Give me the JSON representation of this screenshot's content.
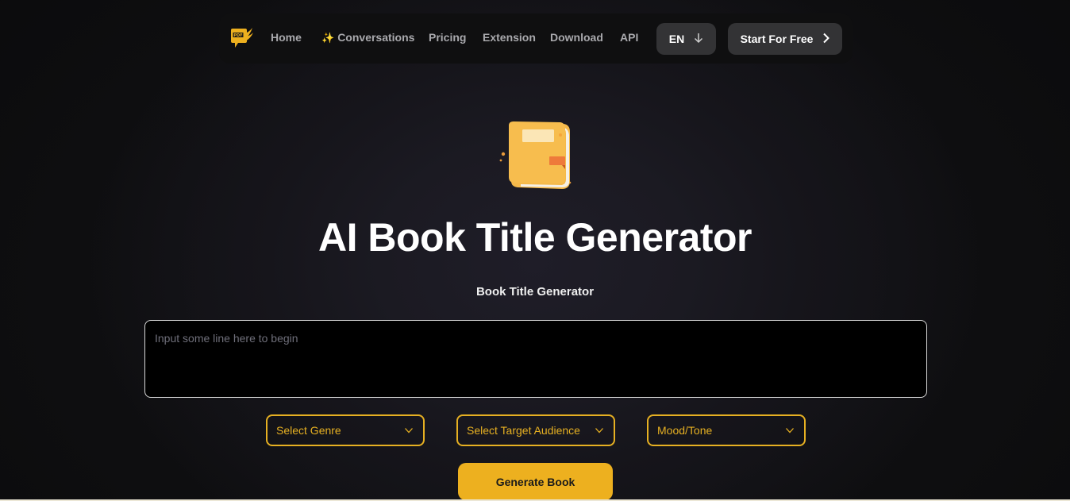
{
  "nav": {
    "logo_text": "PDF",
    "items": [
      {
        "label": "Home"
      },
      {
        "label": "Conversations",
        "icon": "sparkle-icon"
      },
      {
        "label": "Pricing"
      },
      {
        "label": "Extension"
      },
      {
        "label": "Download"
      },
      {
        "label": "API"
      }
    ],
    "language": {
      "label": "EN",
      "icon": "arrow-down-icon"
    },
    "cta": {
      "label": "Start For Free",
      "icon": "chevron-right-icon"
    }
  },
  "hero": {
    "icon": "book-icon",
    "title": "AI Book Title Generator",
    "subtitle": "Book Title Generator"
  },
  "form": {
    "prompt": {
      "value": "",
      "placeholder": "Input some line here to begin"
    },
    "selects": [
      {
        "label": "Select Genre"
      },
      {
        "label": "Select Target Audience"
      },
      {
        "label": "Mood/Tone"
      }
    ],
    "generate_label": "Generate Book"
  },
  "colors": {
    "accent": "#edb01f",
    "select_border": "#e6b022",
    "background": "#0b0b0c",
    "nav_button": "#333335"
  }
}
